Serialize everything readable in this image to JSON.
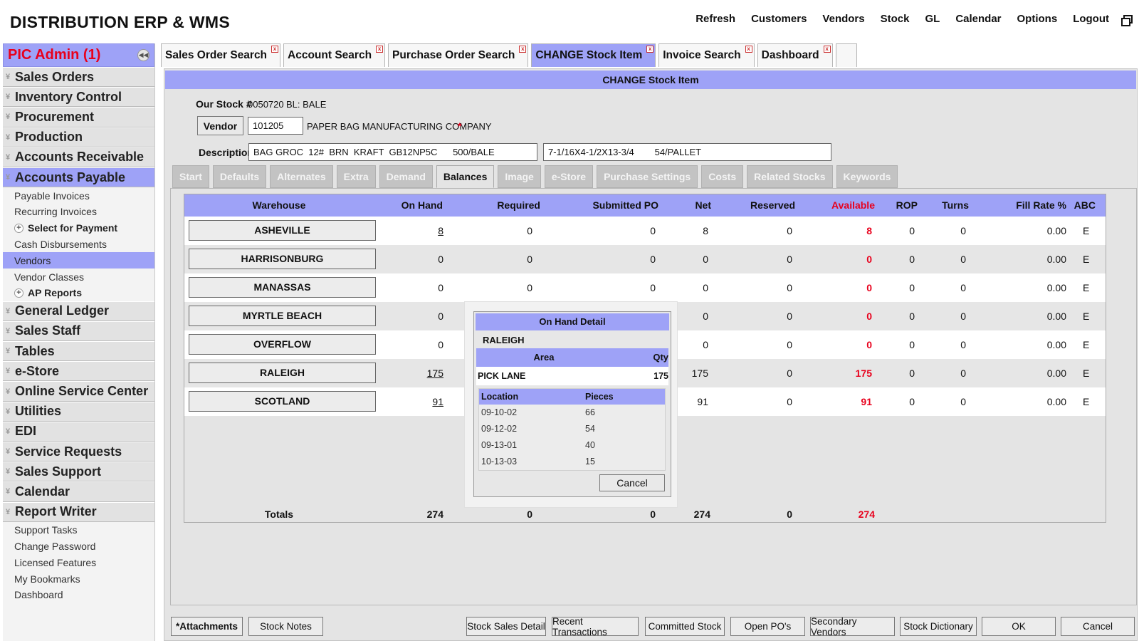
{
  "app": {
    "title": "DISTRIBUTION ERP & WMS"
  },
  "topnav": [
    "Refresh",
    "Customers",
    "Vendors",
    "Stock",
    "GL",
    "Calendar",
    "Options",
    "Logout"
  ],
  "sidebar": {
    "header": "PIC Admin (1)",
    "sections_top": [
      "Sales Orders",
      "Inventory Control",
      "Procurement",
      "Production",
      "Accounts Receivable"
    ],
    "active_section": "Accounts Payable",
    "ap_items": [
      "Payable Invoices",
      "Recurring Invoices",
      "Select for Payment",
      "Cash Disbursements",
      "Vendors",
      "Vendor Classes",
      "AP Reports"
    ],
    "sections_bottom": [
      "General Ledger",
      "Sales Staff",
      "Tables",
      "e-Store",
      "Online Service Center",
      "Utilities",
      "EDI",
      "Service Requests",
      "Sales Support",
      "Calendar",
      "Report Writer"
    ],
    "footer_items": [
      "Support Tasks",
      "Change Password",
      "Licensed Features",
      "My Bookmarks",
      "Dashboard"
    ]
  },
  "tabs": [
    "Sales Order Search",
    "Account Search",
    "Purchase Order Search",
    "CHANGE Stock Item",
    "Invoice Search",
    "Dashboard"
  ],
  "content": {
    "title": "CHANGE Stock Item",
    "our_stock_label": "Our Stock #",
    "our_stock_value": "0050720",
    "bl_value": "BL: BALE",
    "vendor_button": "Vendor",
    "vendor_code": "101205",
    "vendor_name": "PAPER BAG MANUFACTURING COMPANY",
    "required_mark": "*",
    "description_label": "Description",
    "description_1": "BAG GROC  12#  BRN  KRAFT  GB12NP5C      500/BALE",
    "description_2": "7-1/16X4-1/2X13-3/4        54/PALLET"
  },
  "subtabs": [
    "Start",
    "Defaults",
    "Alternates",
    "Extra",
    "Demand",
    "Balances",
    "Image",
    "e-Store",
    "Purchase Settings",
    "Costs",
    "Related Stocks",
    "Keywords"
  ],
  "table": {
    "headers": {
      "warehouse": "Warehouse",
      "on_hand": "On Hand",
      "required": "Required",
      "submitted_po": "Submitted PO",
      "net": "Net",
      "reserved": "Reserved",
      "available": "Available",
      "rop": "ROP",
      "turns": "Turns",
      "fill_rate": "Fill Rate %",
      "abc": "ABC"
    },
    "rows": [
      {
        "warehouse": "ASHEVILLE",
        "on_hand": "8",
        "required": "0",
        "submitted_po": "0",
        "net": "8",
        "reserved": "0",
        "available": "8",
        "rop": "0",
        "turns": "0",
        "fill_rate": "0.00",
        "abc": "E"
      },
      {
        "warehouse": "HARRISONBURG",
        "on_hand": "0",
        "required": "0",
        "submitted_po": "0",
        "net": "0",
        "reserved": "0",
        "available": "0",
        "rop": "0",
        "turns": "0",
        "fill_rate": "0.00",
        "abc": "E"
      },
      {
        "warehouse": "MANASSAS",
        "on_hand": "0",
        "required": "0",
        "submitted_po": "0",
        "net": "0",
        "reserved": "0",
        "available": "0",
        "rop": "0",
        "turns": "0",
        "fill_rate": "0.00",
        "abc": "E"
      },
      {
        "warehouse": "MYRTLE BEACH",
        "on_hand": "0",
        "required": "",
        "submitted_po": "",
        "net": "0",
        "reserved": "0",
        "available": "0",
        "rop": "0",
        "turns": "0",
        "fill_rate": "0.00",
        "abc": "E"
      },
      {
        "warehouse": "OVERFLOW",
        "on_hand": "0",
        "required": "",
        "submitted_po": "",
        "net": "0",
        "reserved": "0",
        "available": "0",
        "rop": "0",
        "turns": "0",
        "fill_rate": "0.00",
        "abc": "E"
      },
      {
        "warehouse": "RALEIGH",
        "on_hand": "175",
        "required": "",
        "submitted_po": "",
        "net": "175",
        "reserved": "0",
        "available": "175",
        "rop": "0",
        "turns": "0",
        "fill_rate": "0.00",
        "abc": "E"
      },
      {
        "warehouse": "SCOTLAND",
        "on_hand": "91",
        "required": "",
        "submitted_po": "",
        "net": "91",
        "reserved": "0",
        "available": "91",
        "rop": "0",
        "turns": "0",
        "fill_rate": "0.00",
        "abc": "E"
      }
    ],
    "totals": {
      "label": "Totals",
      "on_hand": "274",
      "required": "0",
      "submitted_po": "0",
      "net": "274",
      "reserved": "0",
      "available": "274"
    }
  },
  "popup": {
    "title": "On Hand Detail",
    "warehouse": "RALEIGH",
    "area_header": "Area",
    "qty_header": "Qty",
    "area": "PICK LANE",
    "qty": "175",
    "location_header": "Location",
    "pieces_header": "Pieces",
    "locations": [
      {
        "location": "09-10-02",
        "pieces": "66"
      },
      {
        "location": "09-12-02",
        "pieces": "54"
      },
      {
        "location": "09-13-01",
        "pieces": "40"
      },
      {
        "location": "10-13-03",
        "pieces": "15"
      }
    ],
    "cancel": "Cancel"
  },
  "bottom_buttons": [
    "*Attachments",
    "Stock Notes",
    "Stock Sales Detail",
    "Recent Transactions",
    "Committed Stock",
    "Open PO's",
    "Secondary Vendors",
    "Stock Dictionary",
    "OK",
    "Cancel"
  ],
  "colors": {
    "accent": "#9ea2f7",
    "alert": "#e8001c",
    "panel": "#e4e4e4"
  }
}
